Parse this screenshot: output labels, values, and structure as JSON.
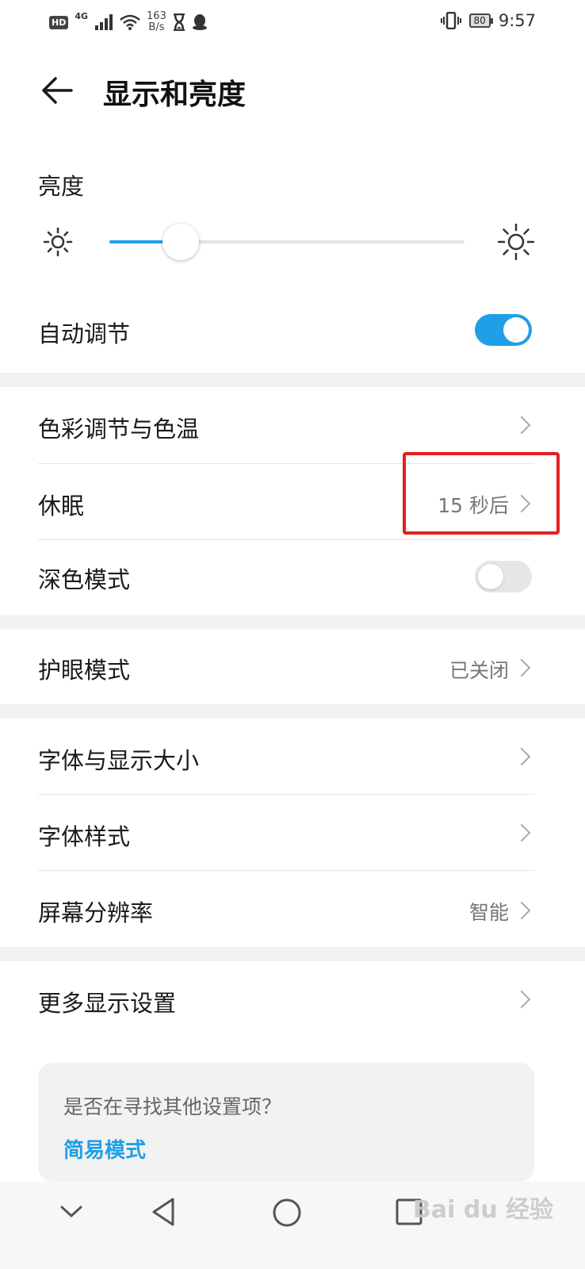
{
  "status_bar": {
    "hd": "HD",
    "signal": "4G",
    "net_speed_value": "163",
    "net_speed_unit": "B/s",
    "battery": "80",
    "time": "9:57"
  },
  "header": {
    "title": "显示和亮度"
  },
  "brightness": {
    "label": "亮度",
    "level_percent": 20
  },
  "auto_adjust": {
    "label": "自动调节",
    "on": true
  },
  "color_temp": {
    "label": "色彩调节与色温"
  },
  "sleep": {
    "label": "休眠",
    "value": "15 秒后"
  },
  "dark_mode": {
    "label": "深色模式",
    "on": false
  },
  "eye_comfort": {
    "label": "护眼模式",
    "value": "已关闭"
  },
  "font_display_size": {
    "label": "字体与显示大小"
  },
  "font_style": {
    "label": "字体样式"
  },
  "resolution": {
    "label": "屏幕分辨率",
    "value": "智能"
  },
  "more_settings": {
    "label": "更多显示设置"
  },
  "hint": {
    "text": "是否在寻找其他设置项？",
    "link": "简易模式"
  },
  "watermark": "Bai du 经验",
  "colors": {
    "accent": "#1e9fe8",
    "highlight": "#e41f1f"
  },
  "icons": [
    "back-arrow-icon",
    "sun-small-icon",
    "sun-large-icon",
    "chevron-right-icon",
    "nav-down-icon",
    "nav-back-icon",
    "nav-home-icon",
    "nav-recents-icon"
  ]
}
